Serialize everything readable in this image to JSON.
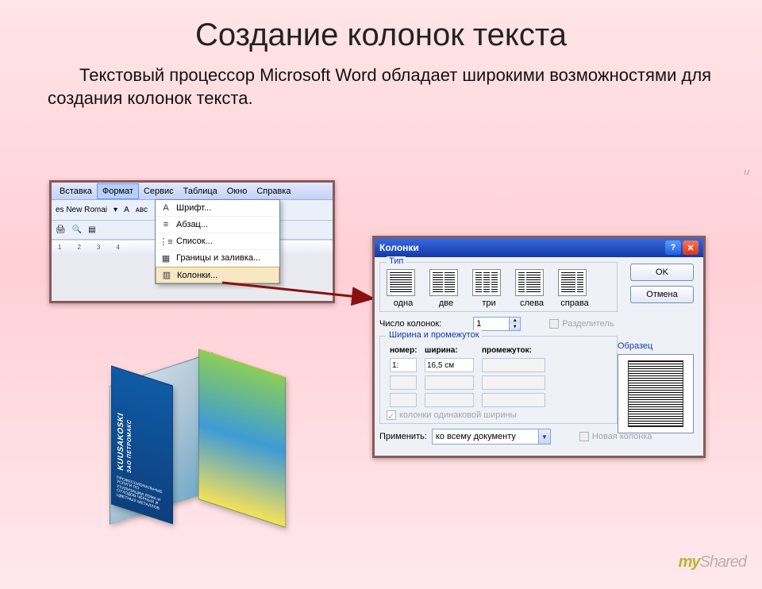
{
  "slide": {
    "title": "Создание колонок текста",
    "lead": "Текстовый процессор Microsoft Word обладает широкими возможностями для создания колонок текста."
  },
  "menu": {
    "items": [
      "Вставка",
      "Формат",
      "Сервис",
      "Таблица",
      "Окно",
      "Справка"
    ],
    "font": "es New Romai",
    "dropdown": [
      "Шрифт...",
      "Абзац...",
      "Список...",
      "Границы и заливка...",
      "Колонки..."
    ]
  },
  "dialog": {
    "title": "Колонки",
    "group_type": "Тип",
    "types": [
      "одна",
      "две",
      "три",
      "слева",
      "справа"
    ],
    "btn_ok": "OK",
    "btn_cancel": "Отмена",
    "lbl_num": "Число колонок:",
    "num_value": "1",
    "chk_separator": "Разделитель",
    "group_width": "Ширина и промежуток",
    "hd_num": "номер:",
    "hd_width": "ширина:",
    "hd_gap": "промежуток:",
    "row1_num": "1:",
    "row1_width": "16,5 см",
    "chk_equal": "колонки одинаковой ширины",
    "lbl_preview": "Образец",
    "lbl_apply": "Применить:",
    "apply_value": "ко всему документу",
    "chk_newcol": "Новая колонка"
  },
  "brochure": {
    "brand": "KUUSAKOSKI",
    "sub": "ЗАО ПЕТРОМАКС",
    "fine": "ПРОФЕССИОНАЛЬНЫЕ УСЛУГИ ПО УТИЛИЗАЦИИ ЛОМА И ОТХОДОВ ЧЁРНЫХ И ЦВЕТНЫХ МЕТАЛЛОВ"
  },
  "watermark": {
    "a": "my",
    "b": "Shared"
  },
  "frag": "u"
}
